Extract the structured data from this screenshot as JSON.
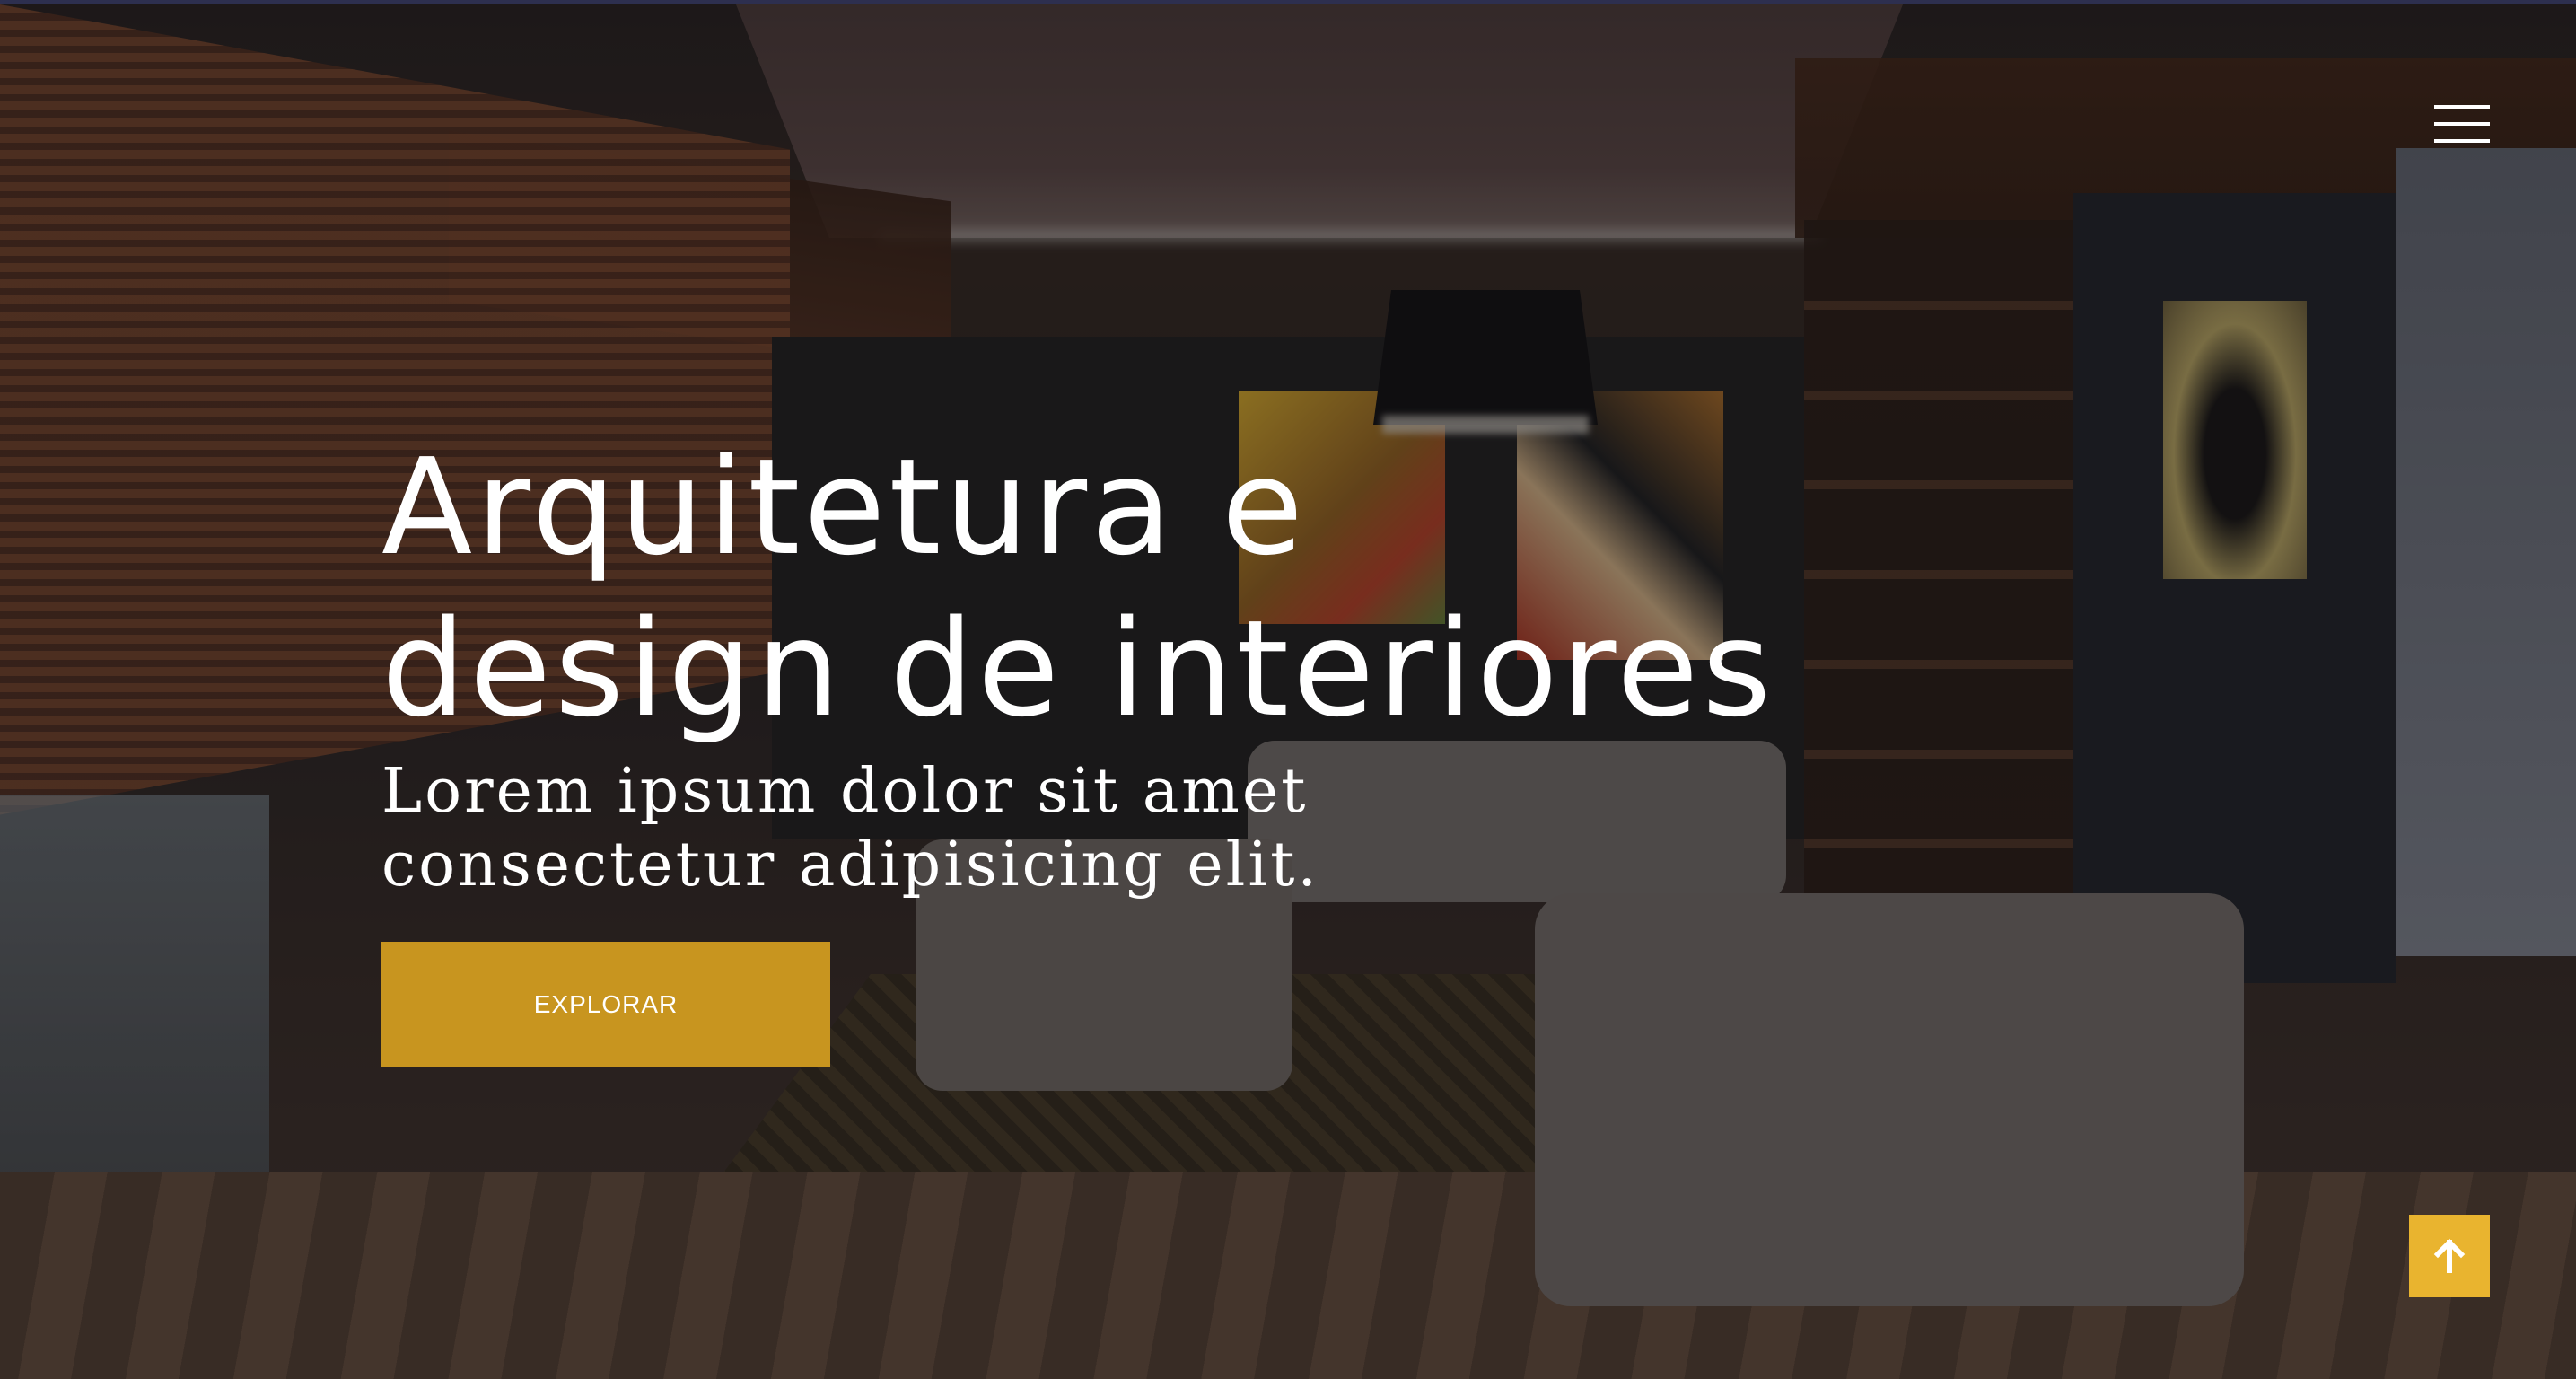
{
  "header": {
    "menu_icon": "hamburger-menu-icon"
  },
  "hero": {
    "title_line1": "Arquitetura e",
    "title_line2": "design de interiores",
    "subtitle": "Lorem ipsum dolor sit amet consectetur adipisicing elit.",
    "cta_label": "EXPLORAR",
    "background_image": "living-room-interior-photo"
  },
  "scroll_top": {
    "icon": "arrow-up-icon"
  },
  "colors": {
    "accent": "#c8951f",
    "scroll_top_bg": "#e9b42f",
    "text": "#ffffff"
  }
}
